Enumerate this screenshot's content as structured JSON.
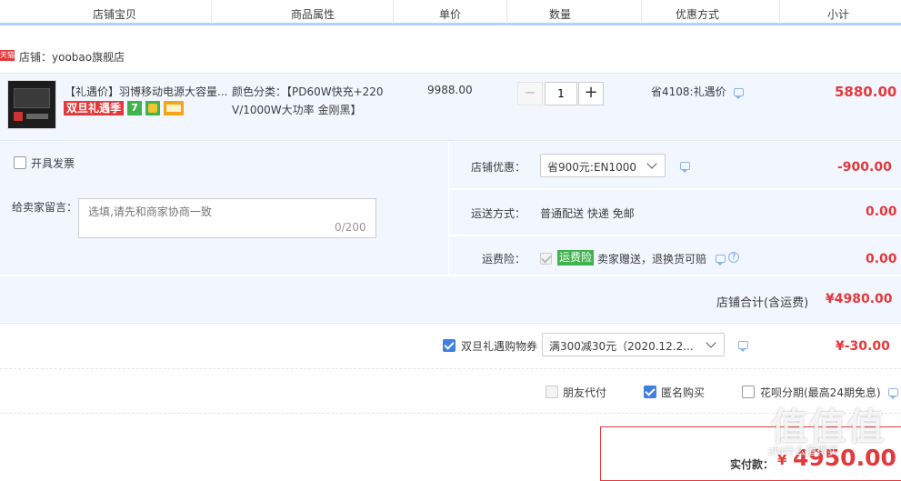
{
  "header": {
    "columns": [
      "店铺宝贝",
      "商品属性",
      "单价",
      "数量",
      "优惠方式",
      "小计"
    ]
  },
  "shop": {
    "badge": "天猫",
    "label": "店铺：yoobao旗舰店"
  },
  "item": {
    "title": "【礼遇价】羽博移动电源大容量...",
    "promo_tag": "双旦礼遇季",
    "attr_line1": "颜色分类：【PD60W快充+220",
    "attr_line2": "V/1000W大功率 金刚黑】",
    "price": "9988.00",
    "quantity": "1",
    "discount": "省4108:礼遇价",
    "subtotal": "5880.00"
  },
  "invoice": {
    "label": "开具发票"
  },
  "message": {
    "label": "给卖家留言：",
    "placeholder": "选填,请先和商家协商一致",
    "counter": "0/200"
  },
  "shop_discount": {
    "label": "店铺优惠：",
    "selected": "省900元:EN1000",
    "amount": "-900.00"
  },
  "shipping": {
    "label": "运送方式：",
    "value": "普通配送 快递 免邮",
    "amount": "0.00"
  },
  "insurance": {
    "label": "运费险：",
    "tag": "运费险",
    "value": "卖家赠送，退换货可赔",
    "amount": "0.00"
  },
  "shop_total": {
    "label": "店铺合计(含运费)",
    "value": "¥4980.00"
  },
  "coupon": {
    "label": "双旦礼遇购物券",
    "selected": "满300减30元（2020.12.2...",
    "amount": "¥-30.00"
  },
  "options": {
    "friend_pay": "朋友代付",
    "anonymous": "匿名购买",
    "huabei": "花呗分期(最高24期免息)"
  },
  "payment": {
    "label": "实付款：",
    "currency": "¥",
    "amount": "4950.00"
  },
  "watermark": {
    "text": "值值值",
    "sub": "zhi什么值得买"
  },
  "colors": {
    "accent_red": "#e4393c",
    "row_bg": "#f2f7ff",
    "header_line": "#b2d1ff",
    "checkbox_blue": "#3f7fe6"
  }
}
